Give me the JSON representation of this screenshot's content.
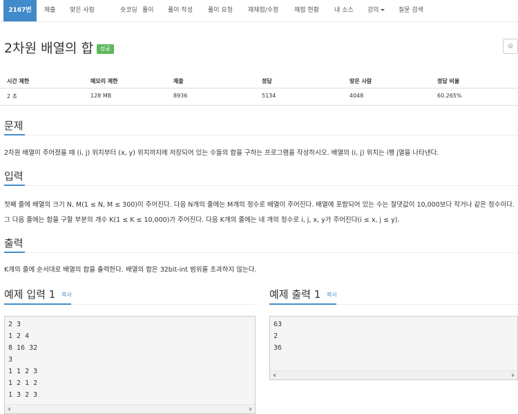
{
  "nav": {
    "items": [
      "2167번",
      "제출",
      "맞은 사람",
      "숏코딩",
      "풀이",
      "풀이 작성",
      "풀이 요청",
      "재채점/수정",
      "채점 현황",
      "내 소스",
      "강의",
      "질문 검색"
    ]
  },
  "problem": {
    "title": "2차원 배열의 합",
    "badge": "성공",
    "star": "☆"
  },
  "stats": {
    "headers": [
      "시간 제한",
      "메모리 제한",
      "제출",
      "정답",
      "맞은 사람",
      "정답 비율"
    ],
    "values": [
      "2 초",
      "128 MB",
      "8936",
      "5134",
      "4048",
      "60.265%"
    ]
  },
  "sections": {
    "problem_h": "문제",
    "problem_text": "2차원 배열이 주어졌을 때 (i, j) 위치부터 (x, y) 위치까지에 저장되어 있는 수들의 합을 구하는 프로그램을 작성하시오. 배열의 (i, j) 위치는 i행 j열을 나타낸다.",
    "input_h": "입력",
    "input_text": "첫째 줄에 배열의 크기 N, M(1 ≤ N, M ≤ 300)이 주어진다. 다음 N개의 줄에는 M개의 정수로 배열이 주어진다. 배열에 포함되어 있는 수는 절댓값이 10,000보다 작거나 같은 정수이다. 그 다음 줄에는 합을 구할 부분의 개수 K(1 ≤ K ≤ 10,000)가 주어진다. 다음 K개의 줄에는 네 개의 정수로 i, j, x, y가 주어진다(i ≤ x, j ≤ y).",
    "output_h": "출력",
    "output_text": "K개의 줄에 순서대로 배열의 합을 출력한다. 배열의 합은 32bit-int 범위를 초과하지 않는다."
  },
  "samples": {
    "input_h": "예제 입력",
    "input_num": "1",
    "output_h": "예제 출력",
    "output_num": "1",
    "copy": "복사",
    "input_lines": [
      "2 3",
      "1 2 4",
      "8 16 32",
      "3",
      "1 1 2 3",
      "1 2 1 2",
      "1 3 2 3"
    ],
    "output_lines": [
      "63",
      "2",
      "36"
    ]
  }
}
